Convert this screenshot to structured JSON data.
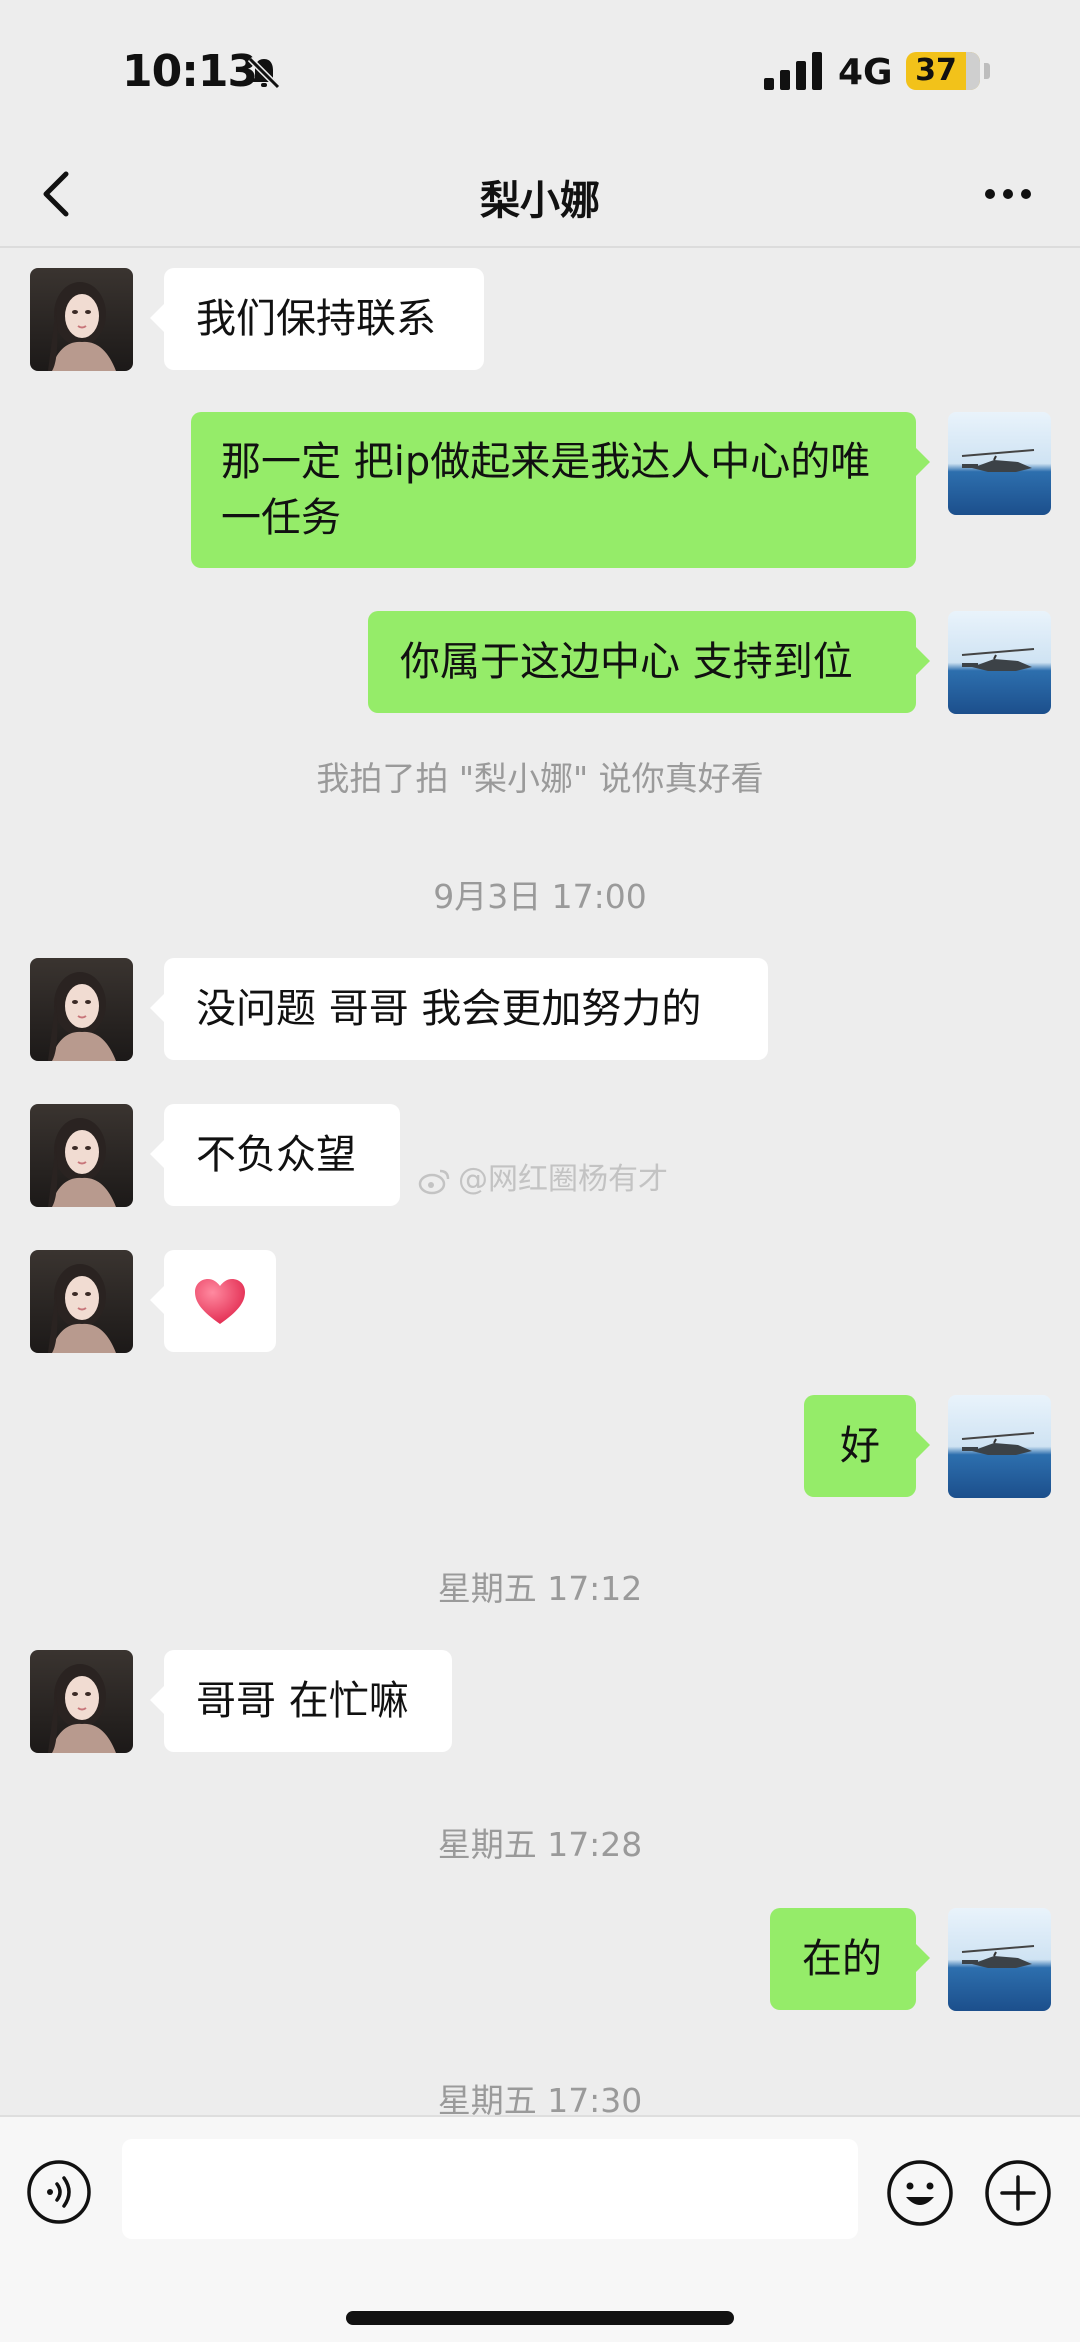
{
  "status_bar": {
    "time": "10:13",
    "network": "4G",
    "battery": "37"
  },
  "header": {
    "title": "梨小娜"
  },
  "messages": [
    {
      "from": "them",
      "text": "我们保持联系"
    },
    {
      "from": "me",
      "text": "那一定 把ip做起来是我达人中心的唯一任务"
    },
    {
      "from": "me",
      "text": "你属于这边中心 支持到位"
    },
    {
      "system": "我拍了拍 \"梨小娜\" 说你真好看"
    },
    {
      "timestamp": "9月3日 17:00"
    },
    {
      "from": "them",
      "text": "没问题 哥哥 我会更加努力的"
    },
    {
      "from": "them",
      "text": "不负众望"
    },
    {
      "from": "them",
      "emoji": "heart"
    },
    {
      "from": "me",
      "text": "好"
    },
    {
      "timestamp": "星期五 17:12"
    },
    {
      "from": "them",
      "text": "哥哥 在忙嘛"
    },
    {
      "timestamp": "星期五 17:28"
    },
    {
      "from": "me",
      "text": "在的"
    },
    {
      "timestamp": "星期五 17:30"
    }
  ],
  "watermark": "@网红圈杨有才",
  "colors": {
    "background": "#ededed",
    "incoming_bubble": "#ffffff",
    "outgoing_bubble": "#95ec69",
    "battery": "#f2c21a"
  },
  "icons": [
    "bell-muted-icon",
    "signal-icon",
    "back-chevron-icon",
    "more-icon",
    "voice-icon",
    "emoji-icon",
    "plus-icon",
    "heart-icon"
  ]
}
